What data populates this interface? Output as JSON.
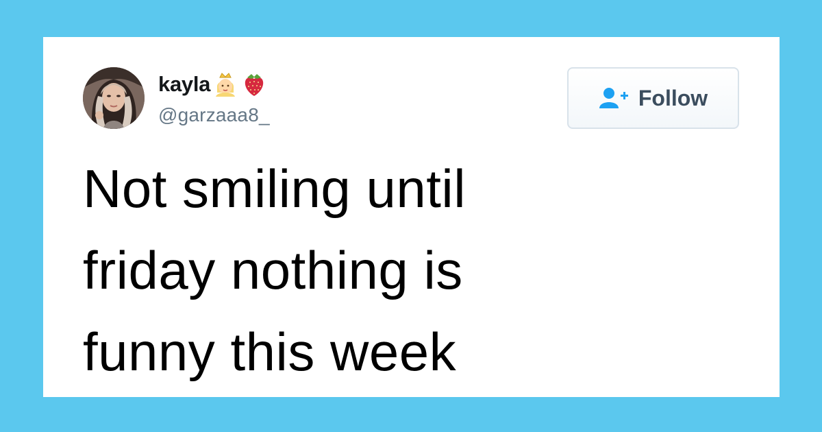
{
  "tweet": {
    "author": {
      "display_name": "kayla",
      "name_emojis": [
        "princess-emoji",
        "strawberry-emoji"
      ],
      "handle": "@garzaaa8_",
      "avatar": "user-avatar-photo"
    },
    "follow_button": {
      "label": "Follow",
      "icon": "add-user-icon"
    },
    "text_lines": [
      "Not smiling until",
      "friday nothing is",
      "funny this week"
    ]
  },
  "colors": {
    "background": "#5bc8ee",
    "card": "#ffffff",
    "follow_icon": "#1da1f2",
    "handle": "#657786"
  }
}
